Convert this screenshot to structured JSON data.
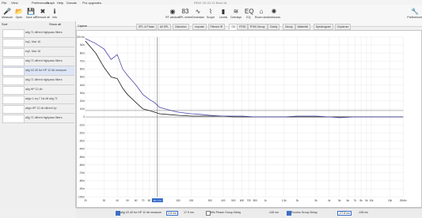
{
  "app": {
    "title": "REW V5.20.13 Beta 18"
  },
  "menu": [
    "File",
    "View",
    "Preferences",
    "Graph",
    "Help",
    "Donate",
    "Pro upgrades"
  ],
  "toolbar_left": [
    {
      "label": "Measure",
      "icon": "microphone-icon",
      "glyph": "🎤"
    },
    {
      "label": "Open",
      "icon": "folder-icon",
      "glyph": "📂"
    },
    {
      "label": "Save all",
      "icon": "save-icon",
      "glyph": "💾"
    },
    {
      "label": "Remove all",
      "icon": "remove-all-icon",
      "glyph": "✖"
    },
    {
      "label": "Info",
      "icon": "info-icon",
      "glyph": "ℹ"
    }
  ],
  "toolbar_mid": [
    {
      "label": "RT window",
      "icon": "rt-window-icon",
      "glyph": "◉"
    },
    {
      "label": "SPL meter",
      "icon": "spl-meter-icon",
      "glyph": "83"
    },
    {
      "label": "Generator",
      "icon": "generator-icon",
      "glyph": "∿"
    },
    {
      "label": "Scope",
      "icon": "scope-icon",
      "glyph": "⌇"
    },
    {
      "label": "Levels",
      "icon": "levels-icon",
      "glyph": "▮"
    },
    {
      "label": "Overlays",
      "icon": "overlays-icon",
      "glyph": "≋"
    },
    {
      "label": "EQ",
      "icon": "eq-icon",
      "glyph": "EQ"
    },
    {
      "label": "Room sim",
      "icon": "room-sim-icon",
      "glyph": "⌂"
    },
    {
      "label": "Ambisonic",
      "icon": "ambisonic-icon",
      "glyph": "✺"
    }
  ],
  "toolbar_right": {
    "label": "Preferences",
    "icon": "preferences-icon",
    "glyph": "🔧"
  },
  "left_panel": {
    "sort_label": "Sort",
    "show_label": "Show all",
    "measurements": [
      "alig 71 difrent highpass filters",
      "eq1, Mar 16",
      "eq2, Mar 16",
      "alig 71 difrent highpass filters",
      "alig V2.40 for HP 12 db measure",
      "alig 71 difrent highpass filters",
      "alig HP 12 db",
      "align 1 eq 7 1st dif alig 71",
      "align HP 12 db difrent hp",
      "alig 71 difrent highpass filters"
    ]
  },
  "capture_label": "Capture",
  "graph_tabs": [
    "SPL & Phase",
    "All SPL",
    "Distortion",
    "Impulse",
    "Filtered IR",
    "GD",
    "RT60",
    "RT60 Decay",
    "Clarity",
    "Decay",
    "Waterfall",
    "Spectrogram",
    "Cepstrum"
  ],
  "active_tab": "GD",
  "right_controls": [
    "Limits",
    "Controls",
    "Smoothing",
    "Freq. Axis",
    "Colours",
    "Axis Ctrl",
    "Graph"
  ],
  "y_tick_labels": [
    "100 ms",
    "90m",
    "80m",
    "70m",
    "60m",
    "50m",
    "40m",
    "30m",
    "20m",
    "10m",
    "0",
    "-10m",
    "-20m",
    "-30m",
    "-40m",
    "-50m",
    "-60m",
    "-70m",
    "-80m",
    "-90m",
    "-100m"
  ],
  "x_tick_labels": [
    "20",
    "30",
    "40",
    "50",
    "60",
    "70",
    "80",
    "90",
    "100",
    "150",
    "200",
    "300",
    "400",
    "500",
    "600",
    "700",
    "800",
    "1k",
    "1.5k",
    "2k",
    "3k",
    "4k",
    "5k",
    "6k",
    "7k",
    "8k",
    "9k",
    "10k",
    "15k",
    "20kHz"
  ],
  "cursor": {
    "x_label": "95.7 Hz"
  },
  "status": {
    "meas_name": "alig V2.40 for HP 12 db measure",
    "primary_value": "4.8 ms",
    "secondary_value": "17.9 ms",
    "minphase_label": "Min Phase Group Delay",
    "minphase_value": "-145 ms",
    "excess_label": "Excess Group Delay",
    "excess_value": "-27.8 ms",
    "excess_value2": "-138 ms"
  },
  "colors": {
    "series_dark": "#1a1a1a",
    "series_blue": "#4a46a8",
    "accent": "#2f65c8",
    "cursor": "#444444"
  },
  "chart_data": {
    "type": "line",
    "xlabel": "",
    "ylabel": "",
    "ylim": [
      -100,
      100
    ],
    "x_scale": "log",
    "xlim": [
      20,
      20000
    ],
    "grid": true,
    "series": [
      {
        "color": "#1a1a1a",
        "x": [
          20,
          25,
          30,
          35,
          40,
          45,
          50,
          60,
          70,
          80,
          90,
          100,
          120,
          150,
          200,
          250,
          300,
          400,
          500,
          600,
          800,
          1000,
          1500,
          2000,
          3000,
          4000,
          5000,
          7000,
          10000,
          14000,
          20000
        ],
        "y": [
          95,
          80,
          62,
          50,
          48,
          36,
          28,
          18,
          10,
          8,
          6,
          4,
          3,
          2,
          1,
          1,
          1,
          1,
          0,
          0,
          0,
          0,
          0,
          0,
          0,
          0,
          0,
          0,
          0,
          0,
          0
        ]
      },
      {
        "color": "#4a46a8",
        "x": [
          20,
          25,
          30,
          35,
          40,
          45,
          50,
          60,
          70,
          80,
          90,
          100,
          120,
          150,
          200,
          250,
          300,
          400,
          500,
          600,
          800,
          1000,
          1500,
          2000,
          3000,
          4000,
          5000,
          7000,
          10000,
          14000,
          20000
        ],
        "y": [
          98,
          92,
          85,
          72,
          78,
          60,
          52,
          40,
          28,
          22,
          18,
          12,
          9,
          6,
          4,
          3,
          2,
          1,
          1,
          1,
          0,
          0,
          0,
          1,
          1,
          0,
          -1,
          0,
          0,
          0,
          0
        ]
      }
    ]
  }
}
